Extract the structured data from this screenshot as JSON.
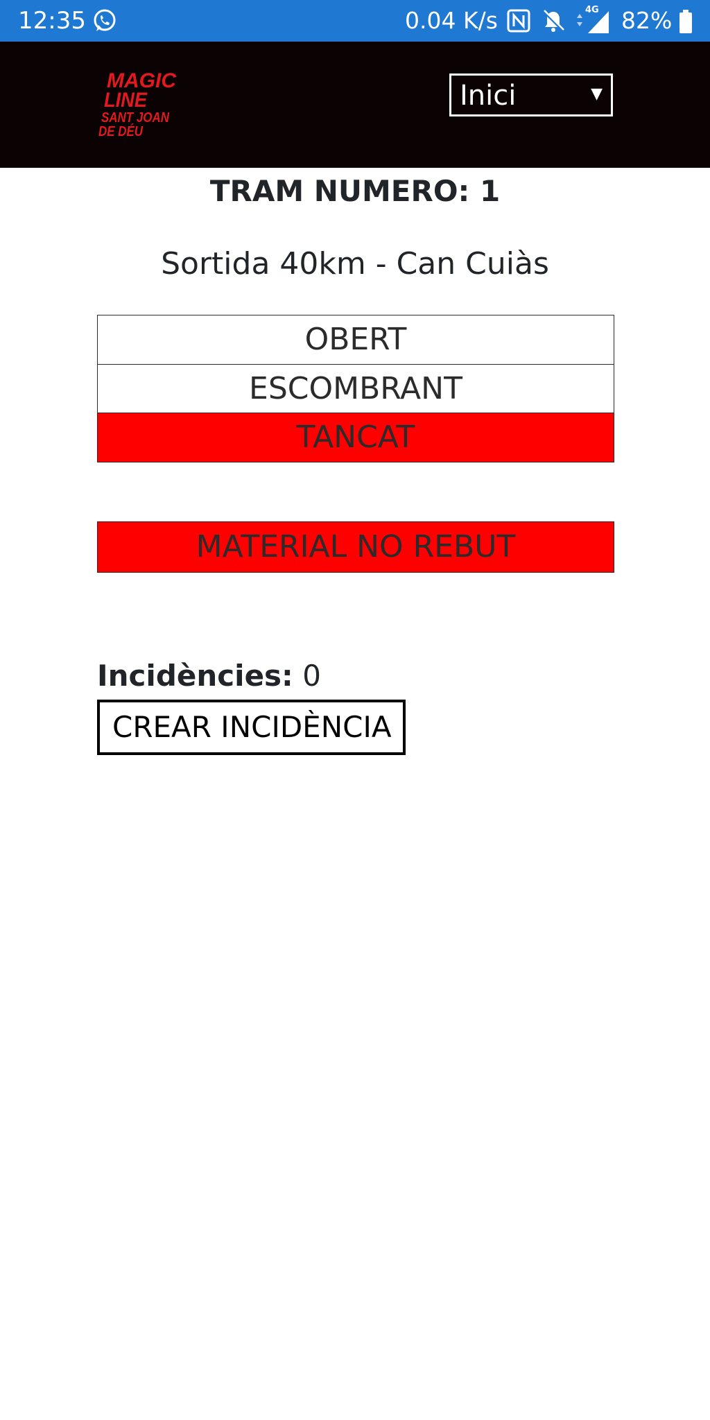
{
  "status_bar": {
    "time": "12:35",
    "speed": "0.04 K/s",
    "network": "4G",
    "battery": "82%",
    "icons": [
      "whatsapp-icon",
      "nfc-icon",
      "bell-off-icon",
      "signal-icon",
      "battery-icon"
    ]
  },
  "header": {
    "logo": {
      "line1": "MAGIC",
      "line2": "LINE",
      "line3": "SANT JOAN",
      "line4": "DE DÉU"
    },
    "nav_select": {
      "value": "Inici"
    }
  },
  "main": {
    "title": "TRAM NUMERO: 1",
    "subtitle": "Sortida 40km - Can Cuiàs",
    "status_options": [
      {
        "label": "OBERT",
        "active": false
      },
      {
        "label": "ESCOMBRANT",
        "active": false
      },
      {
        "label": "TANCAT",
        "active": true
      }
    ],
    "material_button": "MATERIAL NO REBUT",
    "incidences_label": "Incidències:",
    "incidences_count": "0",
    "create_button": "CREAR INCIDÈNCIA"
  },
  "colors": {
    "status_bar": "#1f78d1",
    "header": "#0b0203",
    "active": "#ff0000",
    "logo": "#e01a1f",
    "text": "#212529"
  }
}
